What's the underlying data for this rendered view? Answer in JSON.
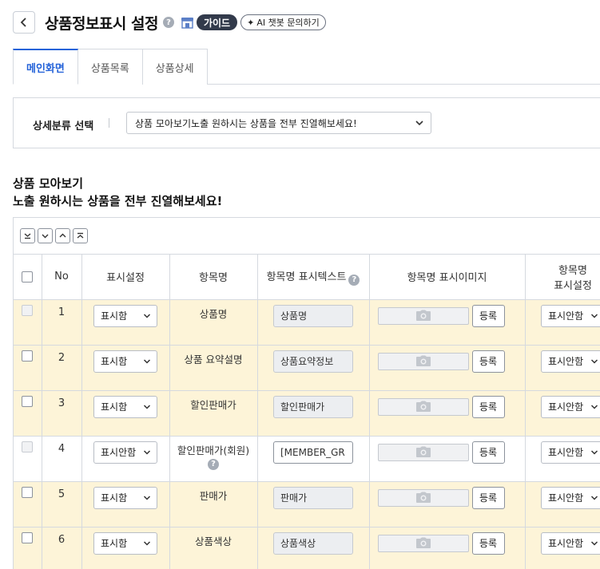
{
  "header": {
    "title": "상품정보표시 설정",
    "guide_label": "가이드",
    "ai_label": "AI 챗봇 문의하기"
  },
  "tabs": [
    {
      "label": "메인화면",
      "active": true
    },
    {
      "label": "상품목록",
      "active": false
    },
    {
      "label": "상품상세",
      "active": false
    }
  ],
  "filter": {
    "label": "상세분류 선택",
    "selected": "상품 모아보기노출 원하시는 상품을 전부 진열해보세요!"
  },
  "section": {
    "title_line1": "상품 모아보기",
    "title_line2": "노출 원하시는 상품을 전부 진열해보세요!"
  },
  "table": {
    "columns": {
      "no": "No",
      "display": "표시설정",
      "item_name": "항목명",
      "name_text": "항목명 표시텍스트",
      "name_image": "항목명 표시이미지",
      "name_display_line1": "항목명",
      "name_display_line2": "표시설정"
    },
    "register_label": "등록",
    "rows": [
      {
        "no": "1",
        "display": "표시함",
        "name": "상품명",
        "text": "상품명",
        "name_display": "표시안함",
        "disabled": true,
        "highlight": true,
        "editable": false,
        "help": false
      },
      {
        "no": "2",
        "display": "표시함",
        "name": "상품 요약설명",
        "text": "상품요약정보",
        "name_display": "표시안함",
        "disabled": false,
        "highlight": true,
        "editable": false,
        "help": false
      },
      {
        "no": "3",
        "display": "표시함",
        "name": "할인판매가",
        "text": "할인판매가",
        "name_display": "표시안함",
        "disabled": false,
        "highlight": true,
        "editable": false,
        "help": false
      },
      {
        "no": "4",
        "display": "표시안함",
        "name": "할인판매가(회원)",
        "text": "[MEMBER_GR",
        "name_display": "표시안함",
        "disabled": true,
        "highlight": false,
        "editable": true,
        "help": true
      },
      {
        "no": "5",
        "display": "표시함",
        "name": "판매가",
        "text": "판매가",
        "name_display": "표시안함",
        "disabled": false,
        "highlight": true,
        "editable": false,
        "help": false
      },
      {
        "no": "6",
        "display": "표시함",
        "name": "상품색상",
        "text": "상품색상",
        "name_display": "표시안함",
        "disabled": false,
        "highlight": true,
        "editable": false,
        "help": false
      }
    ]
  }
}
